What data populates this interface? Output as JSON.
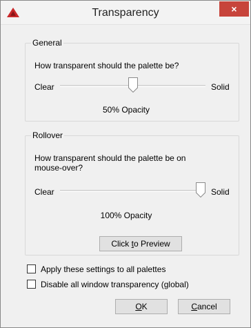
{
  "window": {
    "title": "Transparency",
    "close_glyph": "×"
  },
  "icons": {
    "app": "autocad-logo-icon",
    "close": "close-icon"
  },
  "general": {
    "legend": "General",
    "question": "How transparent should the palette be?",
    "left_label": "Clear",
    "right_label": "Solid",
    "opacity_text": "50% Opacity",
    "slider_value_percent": 50
  },
  "rollover": {
    "legend": "Rollover",
    "question_line1": "How transparent should the palette be on",
    "question_line2": "mouse-over?",
    "left_label": "Clear",
    "right_label": "Solid",
    "opacity_text": "100% Opacity",
    "slider_value_percent": 100,
    "preview_button": {
      "before": "Click ",
      "mnemonic": "t",
      "after": "o Preview"
    }
  },
  "options": {
    "apply_all": {
      "label": "Apply these settings to all palettes",
      "checked": false
    },
    "disable_all": {
      "label": "Disable all window transparency (global)",
      "checked": false
    }
  },
  "buttons": {
    "ok": {
      "mnemonic": "O",
      "rest": "K"
    },
    "cancel": {
      "mnemonic": "C",
      "rest": "ancel"
    }
  },
  "colors": {
    "close_button": "#c7443b",
    "app_icon": "#c8282a"
  }
}
